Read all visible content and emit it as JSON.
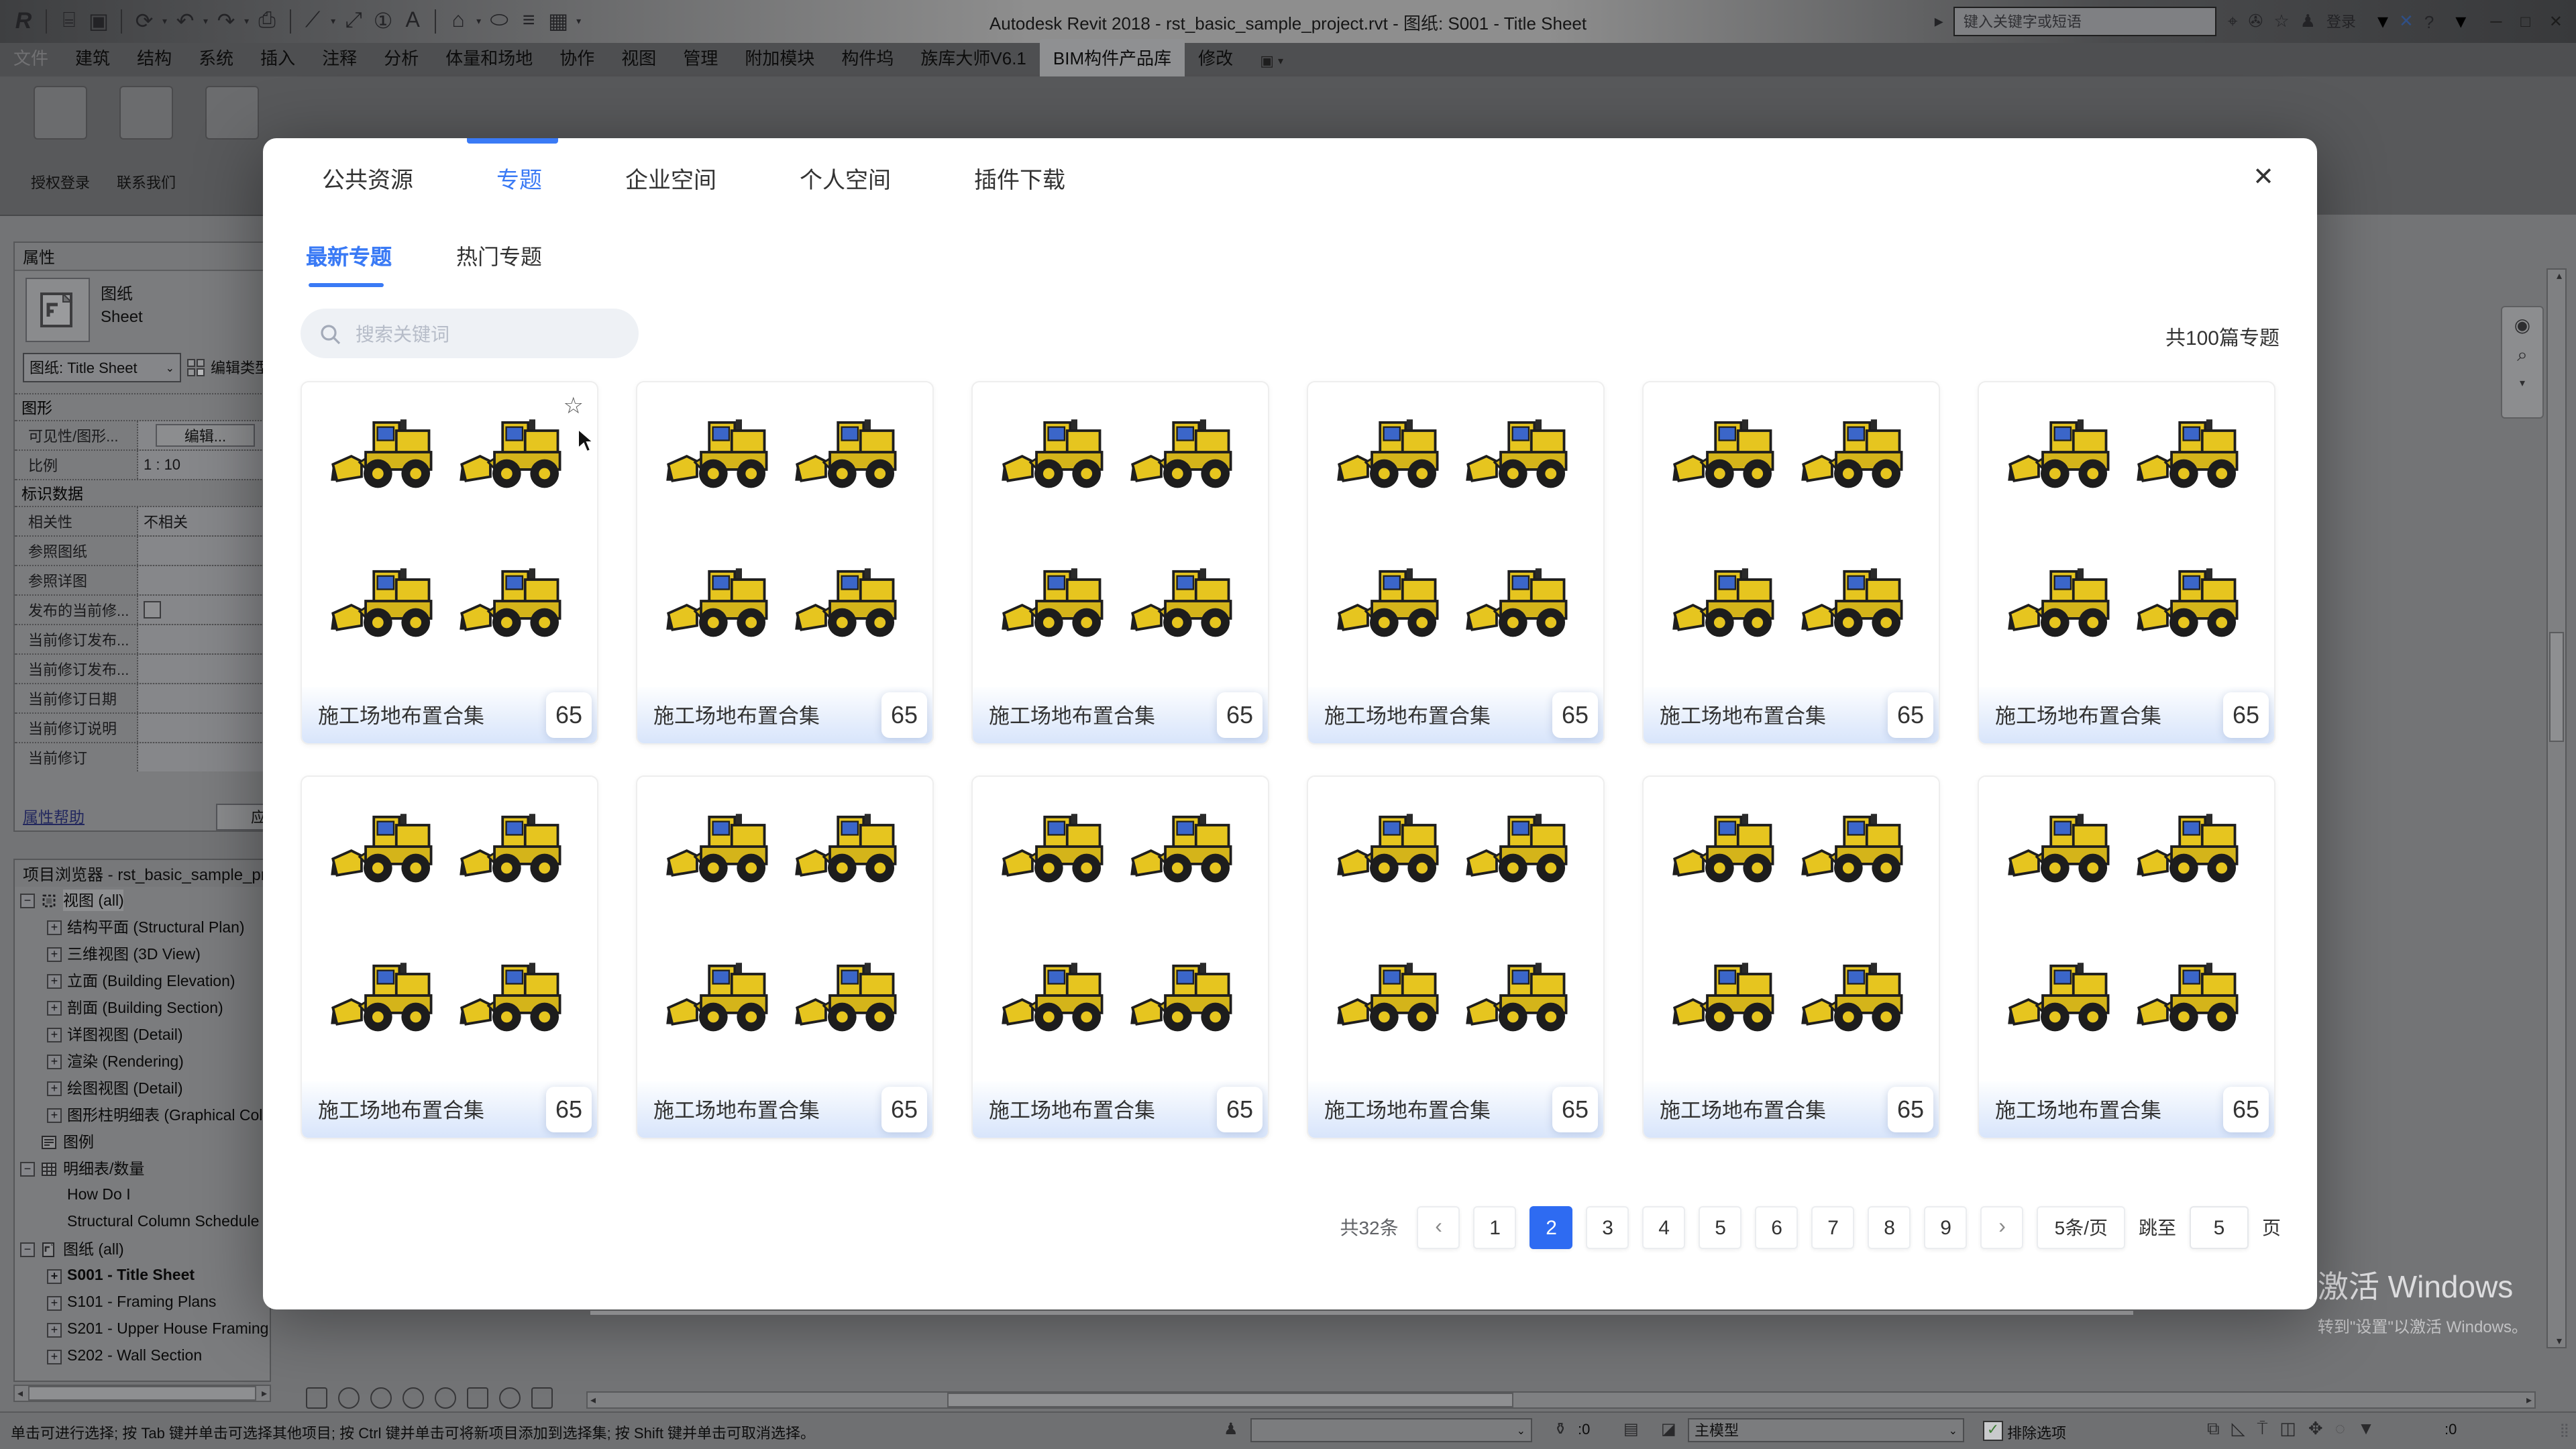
{
  "title_bar": {
    "app_title": "Autodesk Revit 2018  -   rst_basic_sample_project.rvt - 图纸: S001 - Title Sheet",
    "search_placeholder": "键入关键字或短语",
    "signin_label": "登录",
    "quick_access_icons": [
      "revit-logo",
      "open",
      "save",
      "sync",
      "undo",
      "redo",
      "print",
      "measure",
      "aligned-dimension",
      "tag",
      "text",
      "default-3d-view",
      "section",
      "thin-lines",
      "user-interface"
    ],
    "info_icons": [
      "binoculars-search-icon",
      "communication-center-icon",
      "favorites-star-icon",
      "sign-in-person-icon",
      "exchange-apps-icon",
      "help-icon"
    ],
    "window_buttons": [
      "minimize",
      "maximize",
      "close"
    ]
  },
  "ribbon": {
    "tabs": [
      "文件",
      "建筑",
      "结构",
      "系统",
      "插入",
      "注释",
      "分析",
      "体量和场地",
      "协作",
      "视图",
      "管理",
      "附加模块",
      "构件坞",
      "族库大师V6.1",
      "BIM构件产品库",
      "修改"
    ],
    "active_tab": "BIM构件产品库",
    "panel_buttons": [
      "授权登录",
      "联系我们"
    ]
  },
  "properties": {
    "title": "属性",
    "type_label": "图纸",
    "type_label_en": "Sheet",
    "type_selector": "图纸: Title Sheet",
    "edit_type": "编辑类型",
    "sections": [
      {
        "title": "图形",
        "rows": [
          {
            "label": "可见性/图形...",
            "value": "编辑...",
            "kind": "button"
          },
          {
            "label": "比例",
            "value": "1 : 10",
            "kind": "text"
          }
        ]
      },
      {
        "title": "标识数据",
        "rows": [
          {
            "label": "相关性",
            "value": "不相关",
            "kind": "text"
          },
          {
            "label": "参照图纸",
            "value": "",
            "kind": "text"
          },
          {
            "label": "参照详图",
            "value": "",
            "kind": "text"
          },
          {
            "label": "发布的当前修...",
            "value": "",
            "kind": "checkbox"
          },
          {
            "label": "当前修订发布...",
            "value": "",
            "kind": "text"
          },
          {
            "label": "当前修订发布...",
            "value": "",
            "kind": "text"
          },
          {
            "label": "当前修订日期",
            "value": "",
            "kind": "text"
          },
          {
            "label": "当前修订说明",
            "value": "",
            "kind": "text"
          },
          {
            "label": "当前修订",
            "value": "",
            "kind": "text"
          }
        ]
      }
    ],
    "help_link": "属性帮助",
    "apply_label": "应用"
  },
  "project_browser": {
    "title": "项目浏览器 - rst_basic_sample_project.rvt",
    "items": [
      {
        "label": "视图 (all)",
        "depth": 0,
        "expand": "minus",
        "icon": "views",
        "selected": true
      },
      {
        "label": "结构平面 (Structural Plan)",
        "depth": 1,
        "expand": "plus"
      },
      {
        "label": "三维视图 (3D View)",
        "depth": 1,
        "expand": "plus"
      },
      {
        "label": "立面 (Building Elevation)",
        "depth": 1,
        "expand": "plus"
      },
      {
        "label": "剖面 (Building Section)",
        "depth": 1,
        "expand": "plus"
      },
      {
        "label": "详图视图 (Detail)",
        "depth": 1,
        "expand": "plus"
      },
      {
        "label": "渲染 (Rendering)",
        "depth": 1,
        "expand": "plus"
      },
      {
        "label": "绘图视图 (Detail)",
        "depth": 1,
        "expand": "plus"
      },
      {
        "label": "图形柱明细表 (Graphical Column Schedule)",
        "depth": 1,
        "expand": "plus"
      },
      {
        "label": "图例",
        "depth": 0,
        "expand": "none",
        "icon": "legend"
      },
      {
        "label": "明细表/数量",
        "depth": 0,
        "expand": "minus",
        "icon": "schedule"
      },
      {
        "label": "How Do I",
        "depth": 1,
        "expand": "none"
      },
      {
        "label": "Structural Column Schedule",
        "depth": 1,
        "expand": "none"
      },
      {
        "label": "图纸 (all)",
        "depth": 0,
        "expand": "minus",
        "icon": "sheet"
      },
      {
        "label": "S001 - Title Sheet",
        "depth": 1,
        "expand": "plus",
        "bold": true
      },
      {
        "label": "S101 - Framing Plans",
        "depth": 1,
        "expand": "plus"
      },
      {
        "label": "S201 - Upper House Framing",
        "depth": 1,
        "expand": "plus"
      },
      {
        "label": "S202 - Wall Section",
        "depth": 1,
        "expand": "plus"
      }
    ]
  },
  "dialog": {
    "tabs": [
      {
        "label": "公共资源",
        "active": false
      },
      {
        "label": "专题",
        "active": true
      },
      {
        "label": "企业空间",
        "active": false
      },
      {
        "label": "个人空间",
        "active": false
      },
      {
        "label": "插件下载",
        "active": false
      }
    ],
    "subtabs": [
      {
        "label": "最新专题",
        "active": true
      },
      {
        "label": "热门专题",
        "active": false
      }
    ],
    "search_placeholder": "搜索关键词",
    "result_count": "共100篇专题",
    "cards": [
      {
        "title": "施工场地布置合集",
        "count": "65"
      },
      {
        "title": "施工场地布置合集",
        "count": "65"
      },
      {
        "title": "施工场地布置合集",
        "count": "65"
      },
      {
        "title": "施工场地布置合集",
        "count": "65"
      },
      {
        "title": "施工场地布置合集",
        "count": "65"
      },
      {
        "title": "施工场地布置合集",
        "count": "65"
      },
      {
        "title": "施工场地布置合集",
        "count": "65"
      },
      {
        "title": "施工场地布置合集",
        "count": "65"
      },
      {
        "title": "施工场地布置合集",
        "count": "65"
      },
      {
        "title": "施工场地布置合集",
        "count": "65"
      },
      {
        "title": "施工场地布置合集",
        "count": "65"
      },
      {
        "title": "施工场地布置合集",
        "count": "65"
      }
    ],
    "pagination": {
      "total": "共32条",
      "prev": "‹",
      "pages": [
        "1",
        "2",
        "3",
        "4",
        "5",
        "6",
        "7",
        "8",
        "9"
      ],
      "active_page": "2",
      "next": "›",
      "page_size": "5条/页",
      "jump_label": "跳至",
      "jump_value": "5",
      "jump_suffix": "页"
    }
  },
  "status_bar": {
    "hint": "单击可进行选择; 按 Tab 键并单击可选择其他项目; 按 Ctrl 键并单击可将新项目添加到选择集; 按 Shift 键并单击可取消选择。",
    "design_options_count": ":0",
    "main_model_label": "主模型",
    "exclude_options_label": "排除选项",
    "filter_count": ":0",
    "toggle_icons": [
      "select-links-icon",
      "select-underlay-icon",
      "select-pinned-icon",
      "select-by-face-icon",
      "drag-on-selection-icon",
      "reveal-constraints-icon",
      "filter-icon"
    ]
  },
  "watermark": {
    "line1": "激活 Windows",
    "line2": "转到\"设置\"以激活 Windows。"
  },
  "colors": {
    "accent_blue": "#3a7af5",
    "pagination_active": "#2e6bf2",
    "loader_yellow": "#e6c51f",
    "loader_glass": "#3b66c9"
  }
}
